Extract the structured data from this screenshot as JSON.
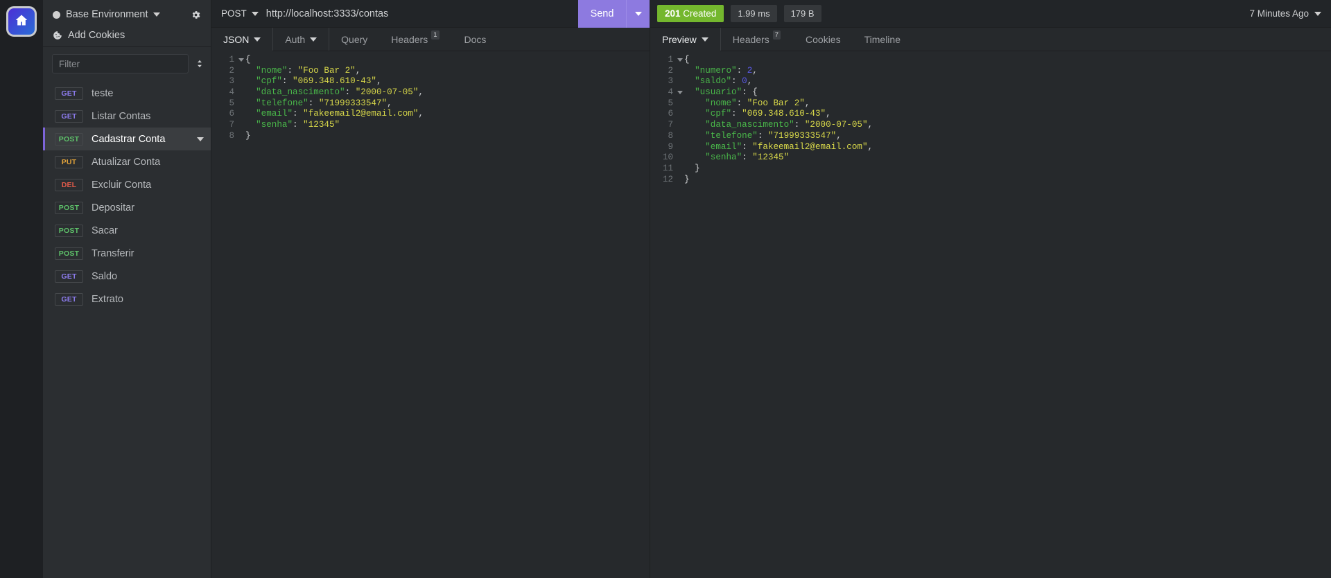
{
  "rail": {
    "home_icon": "home-icon"
  },
  "sidebar": {
    "environment": {
      "name": "Base Environment",
      "icon": "environment-dot-icon",
      "caret": "chevron-down-icon"
    },
    "settings_icon": "gear-icon",
    "cookies": {
      "label": "Add Cookies",
      "icon": "cookie-icon"
    },
    "filter": {
      "placeholder": "Filter",
      "sort_icon": "sort-icon",
      "add_icon": "plus-circle-icon"
    },
    "requests": [
      {
        "method": "GET",
        "name": "teste"
      },
      {
        "method": "GET",
        "name": "Listar Contas"
      },
      {
        "method": "POST",
        "name": "Cadastrar Conta",
        "active": true
      },
      {
        "method": "PUT",
        "name": "Atualizar Conta"
      },
      {
        "method": "DEL",
        "name": "Excluir Conta"
      },
      {
        "method": "POST",
        "name": "Depositar"
      },
      {
        "method": "POST",
        "name": "Sacar"
      },
      {
        "method": "POST",
        "name": "Transferir"
      },
      {
        "method": "GET",
        "name": "Saldo"
      },
      {
        "method": "GET",
        "name": "Extrato"
      }
    ]
  },
  "request": {
    "method": "POST",
    "url": "http://localhost:3333/contas",
    "send_label": "Send",
    "tabs": [
      {
        "label": "JSON",
        "caret": true,
        "selected": true,
        "badge": ""
      },
      {
        "label": "Auth",
        "caret": true,
        "selected": false,
        "badge": ""
      },
      {
        "label": "Query",
        "caret": false,
        "selected": false,
        "badge": ""
      },
      {
        "label": "Headers",
        "caret": false,
        "selected": false,
        "badge": "1"
      },
      {
        "label": "Docs",
        "caret": false,
        "selected": false,
        "badge": ""
      }
    ],
    "body_lines": [
      {
        "n": "1",
        "fold": true,
        "tokens": [
          {
            "t": "{",
            "c": "p"
          }
        ]
      },
      {
        "n": "2",
        "fold": false,
        "tokens": [
          {
            "t": "  \"nome\"",
            "c": "k"
          },
          {
            "t": ": ",
            "c": "p"
          },
          {
            "t": "\"Foo Bar 2\"",
            "c": "s"
          },
          {
            "t": ",",
            "c": "p"
          }
        ]
      },
      {
        "n": "3",
        "fold": false,
        "tokens": [
          {
            "t": "  \"cpf\"",
            "c": "k"
          },
          {
            "t": ": ",
            "c": "p"
          },
          {
            "t": "\"069.348.610-43\"",
            "c": "s"
          },
          {
            "t": ",",
            "c": "p"
          }
        ]
      },
      {
        "n": "4",
        "fold": false,
        "tokens": [
          {
            "t": "  \"data_nascimento\"",
            "c": "k"
          },
          {
            "t": ": ",
            "c": "p"
          },
          {
            "t": "\"2000-07-05\"",
            "c": "s"
          },
          {
            "t": ",",
            "c": "p"
          }
        ]
      },
      {
        "n": "5",
        "fold": false,
        "tokens": [
          {
            "t": "  \"telefone\"",
            "c": "k"
          },
          {
            "t": ": ",
            "c": "p"
          },
          {
            "t": "\"71999333547\"",
            "c": "s"
          },
          {
            "t": ",",
            "c": "p"
          }
        ]
      },
      {
        "n": "6",
        "fold": false,
        "tokens": [
          {
            "t": "  \"email\"",
            "c": "k"
          },
          {
            "t": ": ",
            "c": "p"
          },
          {
            "t": "\"fakeemail2@email.com\"",
            "c": "s"
          },
          {
            "t": ",",
            "c": "p"
          }
        ]
      },
      {
        "n": "7",
        "fold": false,
        "tokens": [
          {
            "t": "  \"senha\"",
            "c": "k"
          },
          {
            "t": ": ",
            "c": "p"
          },
          {
            "t": "\"12345\"",
            "c": "s"
          }
        ]
      },
      {
        "n": "8",
        "fold": false,
        "tokens": [
          {
            "t": "}",
            "c": "p"
          }
        ]
      }
    ]
  },
  "response": {
    "status_code": "201",
    "status_text": "Created",
    "time": "1.99 ms",
    "size": "179 B",
    "history": "7 Minutes Ago",
    "tabs": [
      {
        "label": "Preview",
        "caret": true,
        "selected": true,
        "badge": ""
      },
      {
        "label": "Headers",
        "caret": false,
        "selected": false,
        "badge": "7"
      },
      {
        "label": "Cookies",
        "caret": false,
        "selected": false,
        "badge": ""
      },
      {
        "label": "Timeline",
        "caret": false,
        "selected": false,
        "badge": ""
      }
    ],
    "body_lines": [
      {
        "n": "1",
        "fold": true,
        "tokens": [
          {
            "t": "{",
            "c": "p"
          }
        ]
      },
      {
        "n": "2",
        "fold": false,
        "tokens": [
          {
            "t": "  \"numero\"",
            "c": "k"
          },
          {
            "t": ": ",
            "c": "p"
          },
          {
            "t": "2",
            "c": "n"
          },
          {
            "t": ",",
            "c": "p"
          }
        ]
      },
      {
        "n": "3",
        "fold": false,
        "tokens": [
          {
            "t": "  \"saldo\"",
            "c": "k"
          },
          {
            "t": ": ",
            "c": "p"
          },
          {
            "t": "0",
            "c": "n"
          },
          {
            "t": ",",
            "c": "p"
          }
        ]
      },
      {
        "n": "4",
        "fold": true,
        "tokens": [
          {
            "t": "  \"usuario\"",
            "c": "k"
          },
          {
            "t": ": {",
            "c": "p"
          }
        ]
      },
      {
        "n": "5",
        "fold": false,
        "tokens": [
          {
            "t": "    \"nome\"",
            "c": "k"
          },
          {
            "t": ": ",
            "c": "p"
          },
          {
            "t": "\"Foo Bar 2\"",
            "c": "s"
          },
          {
            "t": ",",
            "c": "p"
          }
        ]
      },
      {
        "n": "6",
        "fold": false,
        "tokens": [
          {
            "t": "    \"cpf\"",
            "c": "k"
          },
          {
            "t": ": ",
            "c": "p"
          },
          {
            "t": "\"069.348.610-43\"",
            "c": "s"
          },
          {
            "t": ",",
            "c": "p"
          }
        ]
      },
      {
        "n": "7",
        "fold": false,
        "tokens": [
          {
            "t": "    \"data_nascimento\"",
            "c": "k"
          },
          {
            "t": ": ",
            "c": "p"
          },
          {
            "t": "\"2000-07-05\"",
            "c": "s"
          },
          {
            "t": ",",
            "c": "p"
          }
        ]
      },
      {
        "n": "8",
        "fold": false,
        "tokens": [
          {
            "t": "    \"telefone\"",
            "c": "k"
          },
          {
            "t": ": ",
            "c": "p"
          },
          {
            "t": "\"71999333547\"",
            "c": "s"
          },
          {
            "t": ",",
            "c": "p"
          }
        ]
      },
      {
        "n": "9",
        "fold": false,
        "tokens": [
          {
            "t": "    \"email\"",
            "c": "k"
          },
          {
            "t": ": ",
            "c": "p"
          },
          {
            "t": "\"fakeemail2@email.com\"",
            "c": "s"
          },
          {
            "t": ",",
            "c": "p"
          }
        ]
      },
      {
        "n": "10",
        "fold": false,
        "tokens": [
          {
            "t": "    \"senha\"",
            "c": "k"
          },
          {
            "t": ": ",
            "c": "p"
          },
          {
            "t": "\"12345\"",
            "c": "s"
          }
        ]
      },
      {
        "n": "11",
        "fold": false,
        "tokens": [
          {
            "t": "  }",
            "c": "p"
          }
        ]
      },
      {
        "n": "12",
        "fold": false,
        "tokens": [
          {
            "t": "}",
            "c": "p"
          }
        ]
      }
    ]
  },
  "colors": {
    "accent": "#8d7ae0",
    "success": "#74b72e",
    "get": "#8e7df0",
    "post": "#5ec16a",
    "put": "#e0a23b",
    "del": "#e05a4a"
  }
}
